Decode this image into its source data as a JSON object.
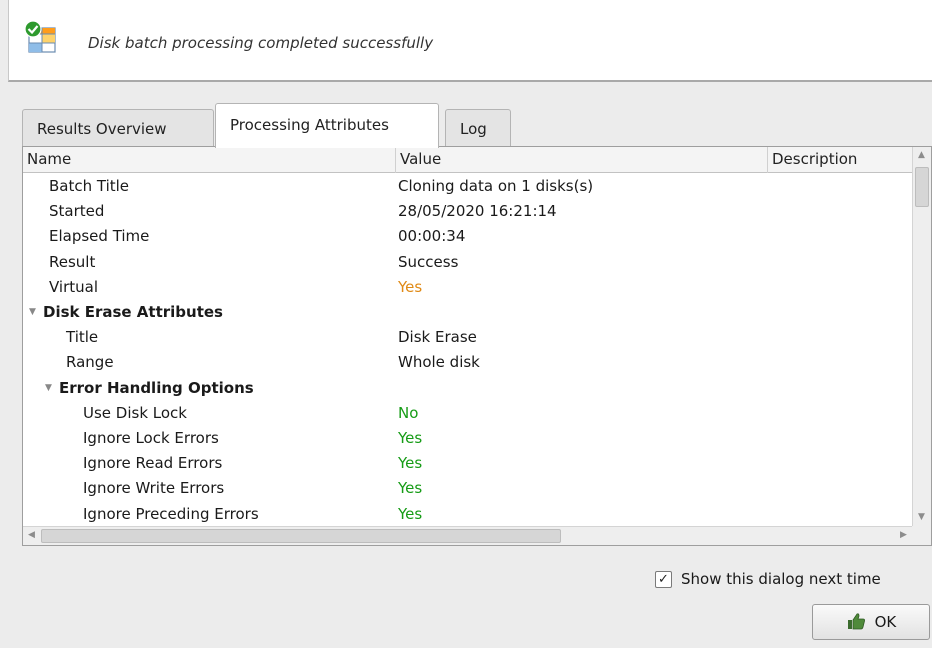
{
  "header": {
    "message": "Disk batch processing completed successfully",
    "icon": "batch-success-icon"
  },
  "tabs": [
    {
      "label": "Results Overview",
      "active": false
    },
    {
      "label": "Processing Attributes",
      "active": true
    },
    {
      "label": "Log",
      "active": false
    }
  ],
  "table": {
    "columns": [
      "Name",
      "Value",
      "Description"
    ],
    "rows": [
      {
        "name": "Batch Title",
        "value": "Cloning data on 1 disks(s)",
        "level": 1
      },
      {
        "name": "Started",
        "value": "28/05/2020 16:21:14",
        "level": 1
      },
      {
        "name": "Elapsed Time",
        "value": "00:00:34",
        "level": 1
      },
      {
        "name": "Result",
        "value": "Success",
        "level": 1
      },
      {
        "name": "Virtual",
        "value": "Yes",
        "level": 1,
        "color": "orange"
      },
      {
        "name": "Disk Erase Attributes",
        "value": "",
        "level": 0,
        "group": true,
        "expanded": true
      },
      {
        "name": "Title",
        "value": "Disk Erase",
        "level": 2
      },
      {
        "name": "Range",
        "value": "Whole disk",
        "level": 2
      },
      {
        "name": "Error Handling Options",
        "value": "",
        "level": 1,
        "group": true,
        "expanded": true
      },
      {
        "name": "Use Disk Lock",
        "value": "No",
        "level": 3,
        "color": "green"
      },
      {
        "name": "Ignore Lock Errors",
        "value": "Yes",
        "level": 3,
        "color": "green"
      },
      {
        "name": "Ignore Read Errors",
        "value": "Yes",
        "level": 3,
        "color": "green"
      },
      {
        "name": "Ignore Write Errors",
        "value": "Yes",
        "level": 3,
        "color": "green"
      },
      {
        "name": "Ignore Preceding Errors",
        "value": "Yes",
        "level": 3,
        "color": "green"
      }
    ]
  },
  "footer": {
    "show_dialog_label": "Show this dialog next time",
    "show_dialog_checked": true,
    "ok_label": "OK",
    "ok_icon": "thumbs-up-icon"
  },
  "colors": {
    "value_orange": "#e08a16",
    "value_green": "#169c16"
  }
}
